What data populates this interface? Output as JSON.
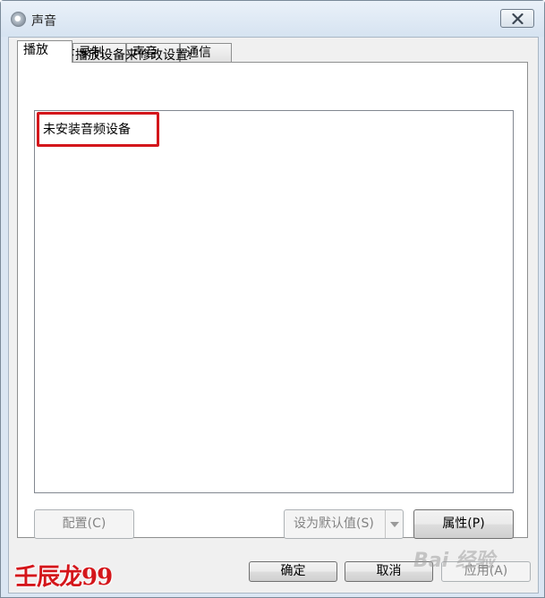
{
  "window": {
    "title": "声音"
  },
  "tabs": [
    {
      "label": "播放",
      "active": true
    },
    {
      "label": "录制",
      "active": false
    },
    {
      "label": "声音",
      "active": false
    },
    {
      "label": "通信",
      "active": false
    }
  ],
  "playback": {
    "instruction": "选择以下播放设备来修改设置:",
    "empty_message": "未安装音频设备"
  },
  "panel_buttons": {
    "configure": "配置(C)",
    "set_default": "设为默认值(S)",
    "properties": "属性(P)"
  },
  "dialog_buttons": {
    "ok": "确定",
    "cancel": "取消",
    "apply": "应用(A)"
  },
  "watermarks": {
    "author": "壬辰龙99",
    "site": "Bai 经验"
  },
  "colors": {
    "highlight_border": "#d3161b",
    "window_frame": "#dbe6f3",
    "dialog_bg": "#f0f0f0"
  }
}
